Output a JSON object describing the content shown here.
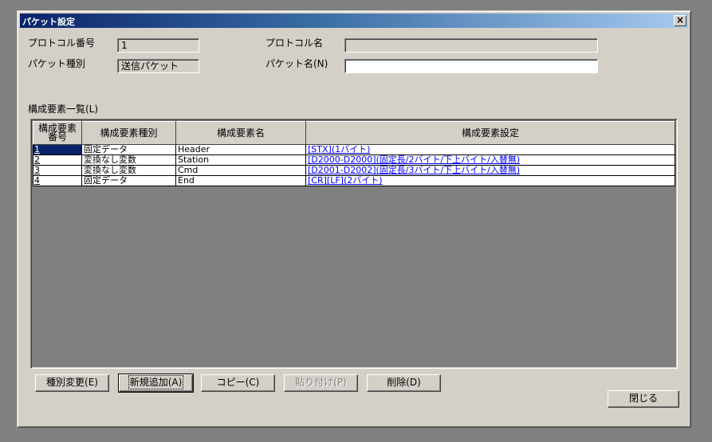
{
  "window": {
    "title": "パケット設定",
    "close_glyph": "×"
  },
  "form": {
    "protocol_no_label": "プロトコル番号",
    "protocol_no_value": "1",
    "protocol_name_label": "プロトコル名",
    "protocol_name_value": "",
    "packet_type_label": "パケット種別",
    "packet_type_value": "送信パケット",
    "packet_name_label": "パケット名(N)",
    "packet_name_value": ""
  },
  "list": {
    "label": "構成要素一覧(L)",
    "headers": [
      "構成要素番号",
      "構成要素種別",
      "構成要素名",
      "構成要素設定"
    ],
    "rows": [
      {
        "no": "1",
        "type": "固定データ",
        "name": "Header",
        "setting": "[STX](1バイト)"
      },
      {
        "no": "2",
        "type": "変換なし変数",
        "name": "Station",
        "setting": "[D2000-D2000](固定長/2バイト/下上バイト/入替無)"
      },
      {
        "no": "3",
        "type": "変換なし変数",
        "name": "Cmd",
        "setting": "[D2001-D2002](固定長/3バイト/下上バイト/入替無)"
      },
      {
        "no": "4",
        "type": "固定データ",
        "name": "End",
        "setting": "[CR][LF](2バイト)"
      }
    ]
  },
  "buttons": {
    "change_type": "種別変更(E)",
    "add_new": "新規追加(A)",
    "copy": "コピー(C)",
    "paste": "貼り付け(P)",
    "delete": "削除(D)",
    "close": "閉じる"
  }
}
